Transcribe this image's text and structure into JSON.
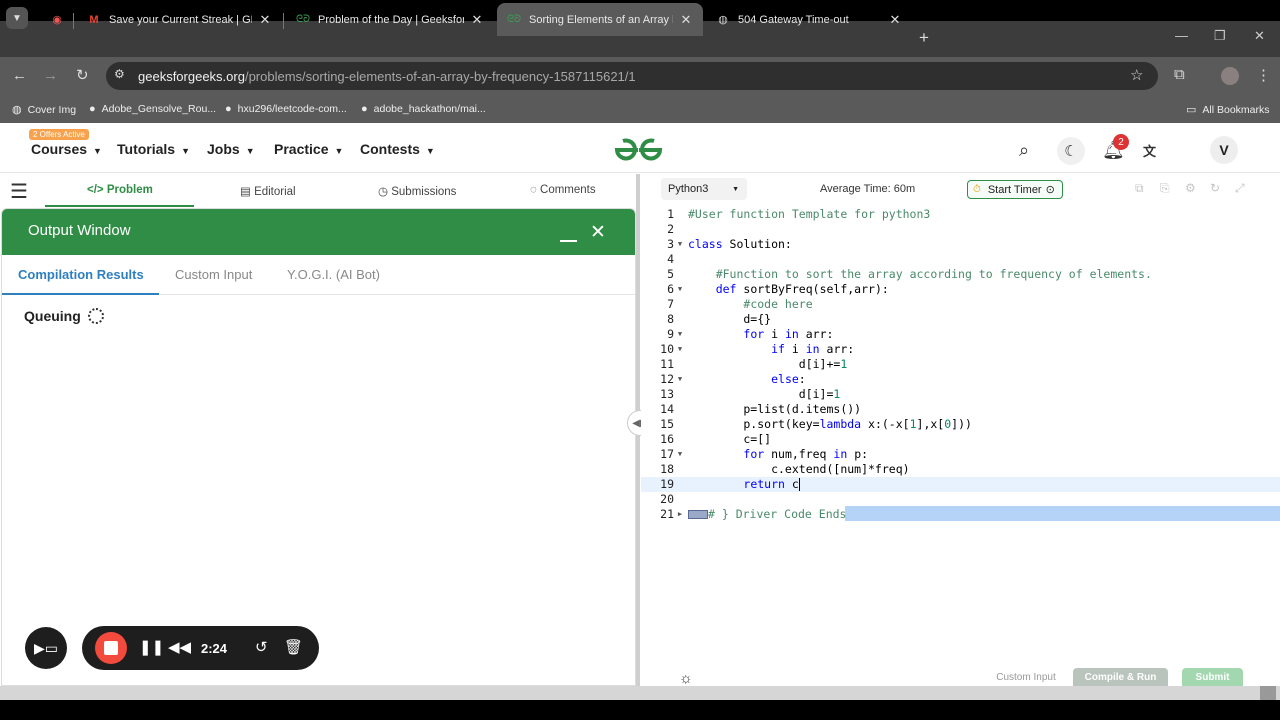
{
  "browser": {
    "tabs": [
      {
        "title": "Save your Current Streak | GFG PO",
        "icon": "gmail-icon"
      },
      {
        "title": "Problem of the Day | GeeksforGeeks",
        "icon": "gfg-icon"
      },
      {
        "title": "Sorting Elements of an Array by Fr",
        "icon": "gfg-icon",
        "active": true
      },
      {
        "title": "504 Gateway Time-out",
        "icon": "globe-icon"
      }
    ],
    "url_domain": "geeksforgeeks.org",
    "url_path": "/problems/sorting-elements-of-an-array-by-frequency-1587115621/1",
    "bookmarks": [
      "Cover Img",
      "Adobe_Gensolve_Rou...",
      "hxu296/leetcode-com...",
      "adobe_hackathon/mai...",
      "All Bookmarks"
    ]
  },
  "header": {
    "offers": "2 Offers Active",
    "menu": [
      "Courses",
      "Tutorials",
      "Jobs",
      "Practice",
      "Contests"
    ],
    "notifications": "2",
    "avatar": "V",
    "brand_color": "#2f8d46"
  },
  "problem_tabs": [
    "Problem",
    "Editorial",
    "Submissions",
    "Comments"
  ],
  "output": {
    "title": "Output Window",
    "tabs": [
      "Compilation Results",
      "Custom Input",
      "Y.O.G.I. (AI Bot)"
    ],
    "status": "Queuing"
  },
  "editor": {
    "language": "Python3",
    "avg_time": "Average Time: 60m",
    "timer": "Start Timer",
    "current_line": 19,
    "lines": [
      "#User function Template for python3",
      "",
      "class Solution:",
      "",
      "    #Function to sort the array according to frequency of elements.",
      "    def sortByFreq(self,arr):",
      "        #code here",
      "        d={}",
      "        for i in arr:",
      "            if i in arr:",
      "                d[i]+=1",
      "            else:",
      "                d[i]=1",
      "        p=list(d.items())",
      "        p.sort(key=lambda x:(-x[1],x[0]))",
      "        c=[]",
      "        for num,freq in p:",
      "            c.extend([num]*freq)",
      "        return c",
      "",
      "# } Driver Code Ends"
    ],
    "buttons": [
      "Custom Input",
      "Compile & Run",
      "Submit"
    ]
  },
  "recorder": {
    "time": "2:24"
  }
}
